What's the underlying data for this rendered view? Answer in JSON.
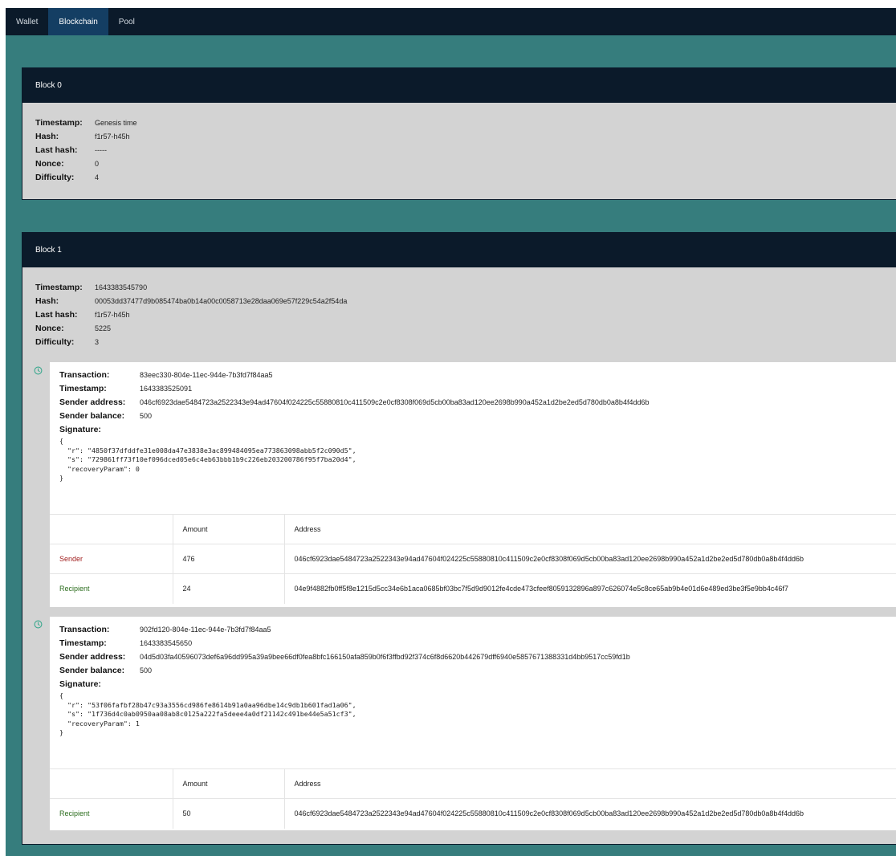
{
  "nav": {
    "tabs": [
      {
        "label": "Wallet"
      },
      {
        "label": "Blockchain"
      },
      {
        "label": "Pool"
      }
    ]
  },
  "labels": {
    "timestamp": "Timestamp:",
    "hash": "Hash:",
    "last_hash": "Last hash:",
    "nonce": "Nonce:",
    "difficulty": "Difficulty:",
    "transaction": "Transaction:",
    "sender_address": "Sender address:",
    "sender_balance": "Sender balance:",
    "signature": "Signature:",
    "amount_header": "Amount",
    "address_header": "Address"
  },
  "blocks": [
    {
      "title": "Block 0",
      "timestamp": "Genesis time",
      "hash": "f1r57-h45h",
      "last_hash": "-----",
      "nonce": "0",
      "difficulty": "4"
    },
    {
      "title": "Block 1",
      "timestamp": "1643383545790",
      "hash": "00053dd37477d9b085474ba0b14a00c0058713e28daa069e57f229c54a2f54da",
      "last_hash": "f1r57-h45h",
      "nonce": "5225",
      "difficulty": "3",
      "transactions": [
        {
          "id": "83eec330-804e-11ec-944e-7b3fd7f84aa5",
          "timestamp": "1643383525091",
          "sender_address": "046cf6923dae5484723a2522343e94ad47604f024225c55880810c411509c2e0cf8308f069d5cb00ba83ad120ee2698b990a452a1d2be2ed5d780db0a8b4f4dd6b",
          "sender_balance": "500",
          "signature": "{\n  \"r\": \"4850f37dfddfe31e008da47e3838e3ac899484095ea773863098abb5f2c090d5\",\n  \"s\": \"729861ff73f10ef096dced05e6c4eb63bbb1b9c226eb203200786f95f7ba20d4\",\n  \"recoveryParam\": 0\n}",
          "outputs": [
            {
              "role": "Sender",
              "amount": "476",
              "address": "046cf6923dae5484723a2522343e94ad47604f024225c55880810c411509c2e0cf8308f069d5cb00ba83ad120ee2698b990a452a1d2be2ed5d780db0a8b4f4dd6b"
            },
            {
              "role": "Recipient",
              "amount": "24",
              "address": "04e9f4882fb0ff5f8e1215d5cc34e6b1aca0685bf03bc7f5d9d9012fe4cde473cfeef8059132896a897c626074e5c8ce65ab9b4e01d6e489ed3be3f5e9bb4c46f7"
            }
          ]
        },
        {
          "id": "902fd120-804e-11ec-944e-7b3fd7f84aa5",
          "timestamp": "1643383545650",
          "sender_address": "04d5d03fa40596073def6a96dd995a39a9bee66df0fea8bfc166150afa859b0f6f3ffbd92f374c6f8d6620b442679dff6940e5857671388331d4bb9517cc59fd1b",
          "sender_balance": "500",
          "signature": "{\n  \"r\": \"53f06fafbf28b47c93a3556cd986fe8614b91a0aa96dbe14c9db1b601fad1a06\",\n  \"s\": \"1f736d4c0ab0950aa08ab8c0125a222fa5deee4a0df21142c491be44e5a51cf3\",\n  \"recoveryParam\": 1\n}",
          "outputs": [
            {
              "role": "Recipient",
              "amount": "50",
              "address": "046cf6923dae5484723a2522343e94ad47604f024225c55880810c411509c2e0cf8308f069d5cb00ba83ad120ee2698b990a452a1d2be2ed5d780db0a8b4f4dd6b"
            }
          ]
        }
      ]
    }
  ],
  "colors": {
    "background": "#367d7d",
    "header": "#0b1a2a",
    "active_tab": "#143e63",
    "panel": "#d3d3d3",
    "sender": "#a12020",
    "recipient": "#2d6e1f"
  }
}
